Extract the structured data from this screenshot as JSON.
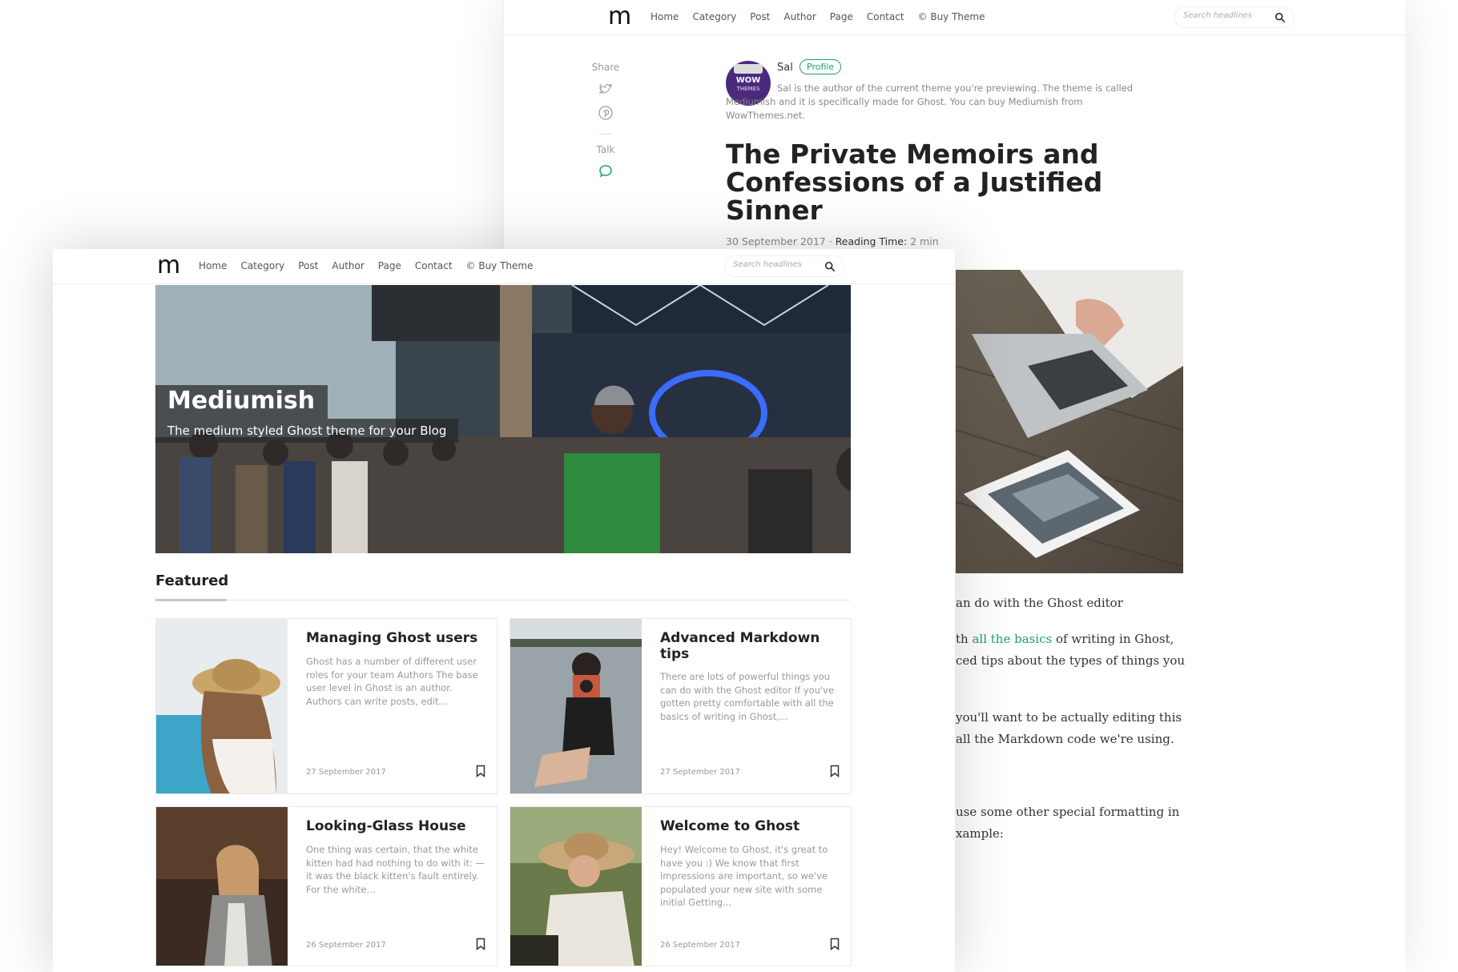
{
  "nav": {
    "logo": "m",
    "links": [
      "Home",
      "Category",
      "Post",
      "Author",
      "Page",
      "Contact",
      "© Buy Theme"
    ],
    "search_placeholder": "Search headlines"
  },
  "share": {
    "share_label": "Share",
    "talk_label": "Talk"
  },
  "author": {
    "name": "Sal",
    "badge": "Profile",
    "bio": "Sal is the author of the current theme you're previewing. The theme is called Mediumish and it is specifically made for Ghost. You can buy Mediumish from WowThemes.net.",
    "avatar_line1": "WOW",
    "avatar_line2": "THEMES"
  },
  "post": {
    "title": "The Private Memoirs and Confessions of a Justified Sinner",
    "date": "30 September 2017",
    "reading_label": "Reading Time:",
    "reading_value": "2 min",
    "body": {
      "p1": "an do with the Ghost editor",
      "p2a": "th ",
      "p2_link": "all the basics",
      "p2b": " of writing in Ghost,",
      "p2c": "ced tips about the types of things you",
      "p3a": "you'll want to be actually editing this",
      "p3b": "all the Markdown code we're using.",
      "p4a": " use some other special formatting in",
      "p4b": "xample:"
    }
  },
  "hero": {
    "title": "Mediumish",
    "subtitle": "The medium styled Ghost theme for your Blog"
  },
  "featured": {
    "heading": "Featured",
    "cards": [
      {
        "title": "Managing Ghost users",
        "excerpt": "Ghost has a number of different user roles for your team Authors The base user level in Ghost is an author. Authors can write posts, edit...",
        "date": "27 September 2017"
      },
      {
        "title": "Advanced Markdown tips",
        "excerpt": "There are lots of powerful things you can do with the Ghost editor If you've gotten pretty comfortable with all the basics of writing in Ghost,...",
        "date": "27 September 2017"
      },
      {
        "title": "Looking-Glass House",
        "excerpt": "One thing was certain, that the white kitten had had nothing to do with it: — it was the black kitten's fault entirely. For the white...",
        "date": "26 September 2017"
      },
      {
        "title": "Welcome to Ghost",
        "excerpt": "Hey! Welcome to Ghost, it's great to have you :) We know that first impressions are important, so we've populated your new site with some initial Getting...",
        "date": "26 September 2017"
      }
    ]
  },
  "icons": {
    "search": "search-icon",
    "twitter": "twitter-icon",
    "pinterest": "pinterest-icon",
    "comment": "comment-icon",
    "bookmark": "bookmark-icon"
  },
  "colors": {
    "accent": "#1f9e6e",
    "avatar_bg": "#4b2a7c"
  }
}
